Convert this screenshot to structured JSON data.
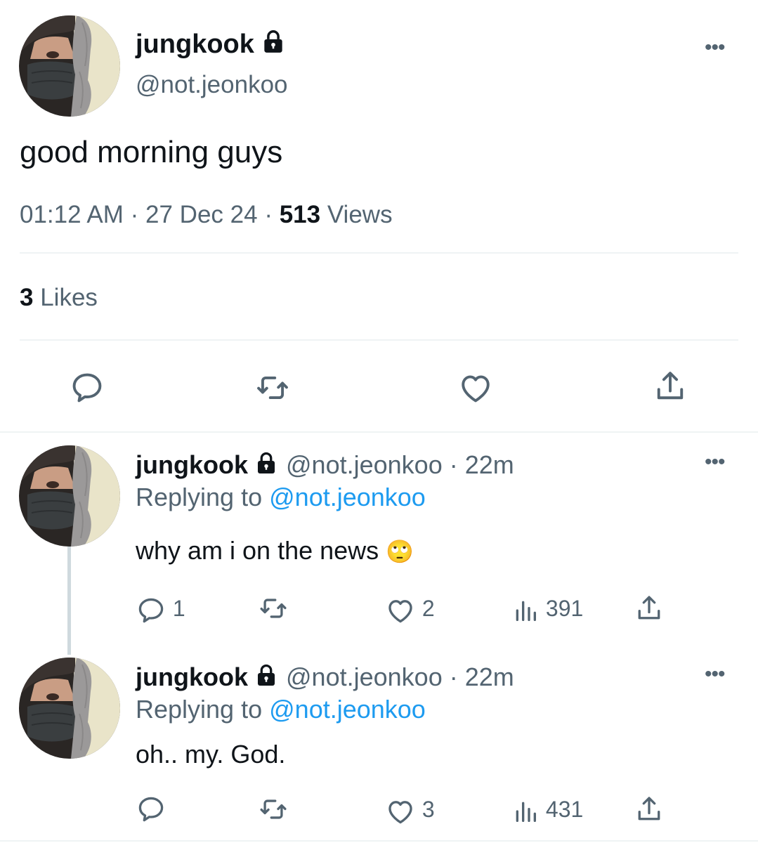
{
  "main_tweet": {
    "display_name": "jungkook",
    "handle": "@not.jeonkoo",
    "text": "good morning guys",
    "time": "01:12 AM",
    "date": "27 Dec 24",
    "views_count": "513",
    "views_label": "Views",
    "likes_count": "3",
    "likes_label": "Likes",
    "separator": "·"
  },
  "replies": [
    {
      "display_name": "jungkook",
      "handle": "@not.jeonkoo",
      "time_ago": "· 22m",
      "replying_label": "Replying to",
      "replying_handle": "@not.jeonkoo",
      "text": "why am i on the news",
      "emoji": "🙄",
      "reply_count": "1",
      "like_count": "2",
      "view_count": "391"
    },
    {
      "display_name": "jungkook",
      "handle": "@not.jeonkoo",
      "time_ago": "· 22m",
      "replying_label": "Replying to",
      "replying_handle": "@not.jeonkoo",
      "text": "oh.. my. God.",
      "reply_count": "",
      "like_count": "3",
      "view_count": "431"
    }
  ],
  "colors": {
    "text": "#0f1419",
    "muted": "#536471",
    "link": "#1d9bf0",
    "divider": "#eff3f4"
  },
  "icons": [
    "more-icon",
    "lock-icon",
    "reply-icon",
    "retweet-icon",
    "like-icon",
    "views-icon",
    "share-icon"
  ]
}
